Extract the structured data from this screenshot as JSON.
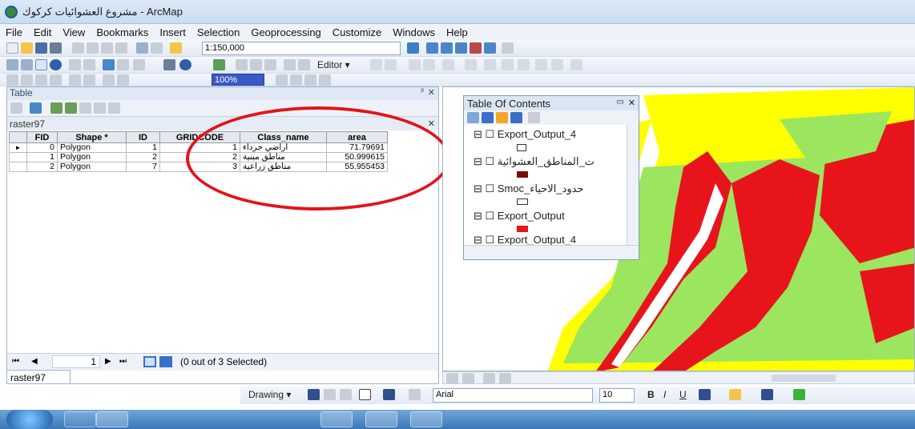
{
  "window": {
    "title": "مشروع العشوائيات كركوك - ArcMap"
  },
  "menu": [
    "File",
    "Edit",
    "View",
    "Bookmarks",
    "Insert",
    "Selection",
    "Geoprocessing",
    "Customize",
    "Windows",
    "Help"
  ],
  "toolbar": {
    "scale": "1:150,000",
    "editor_label": "Editor ▾",
    "zoom_label": "100%"
  },
  "table_window": {
    "title": "Table",
    "layer_name": "raster97",
    "columns": [
      "FID",
      "Shape *",
      "ID",
      "GRIDCODE",
      "Class_name",
      "area"
    ],
    "rows": [
      [
        "0",
        "Polygon",
        "1",
        "1",
        "اراضي جرداء",
        "71.79691"
      ],
      [
        "1",
        "Polygon",
        "2",
        "2",
        "مناطق مبنية",
        "50.999615"
      ],
      [
        "2",
        "Polygon",
        "7",
        "3",
        "مناطق زراعية",
        "55.955453"
      ]
    ],
    "record_index": "1",
    "selection_status": "(0 out of 3 Selected)",
    "tab_label": "raster97"
  },
  "toc": {
    "title": "Table Of Contents",
    "items": [
      {
        "label": "Export_Output_4",
        "swatch": "#ffffff"
      },
      {
        "label": "ت_المناطق_العشوائية",
        "swatch": "#7b0c0c"
      },
      {
        "label": "Smoc_حدود_الاحياء",
        "swatch": "#ffffff"
      },
      {
        "label": "Export_Output",
        "swatch": "#e8141c"
      },
      {
        "label": "Export_Output_4",
        "swatch": "#22c522"
      }
    ]
  },
  "drawing": {
    "label": "Drawing ▾",
    "font": "Arial",
    "size": "10"
  },
  "colors": {
    "map_yellow": "#ffff00",
    "map_green": "#9be65e",
    "map_red": "#e8141c",
    "map_white": "#ffffff",
    "highlight_circle": "#e2141b"
  }
}
